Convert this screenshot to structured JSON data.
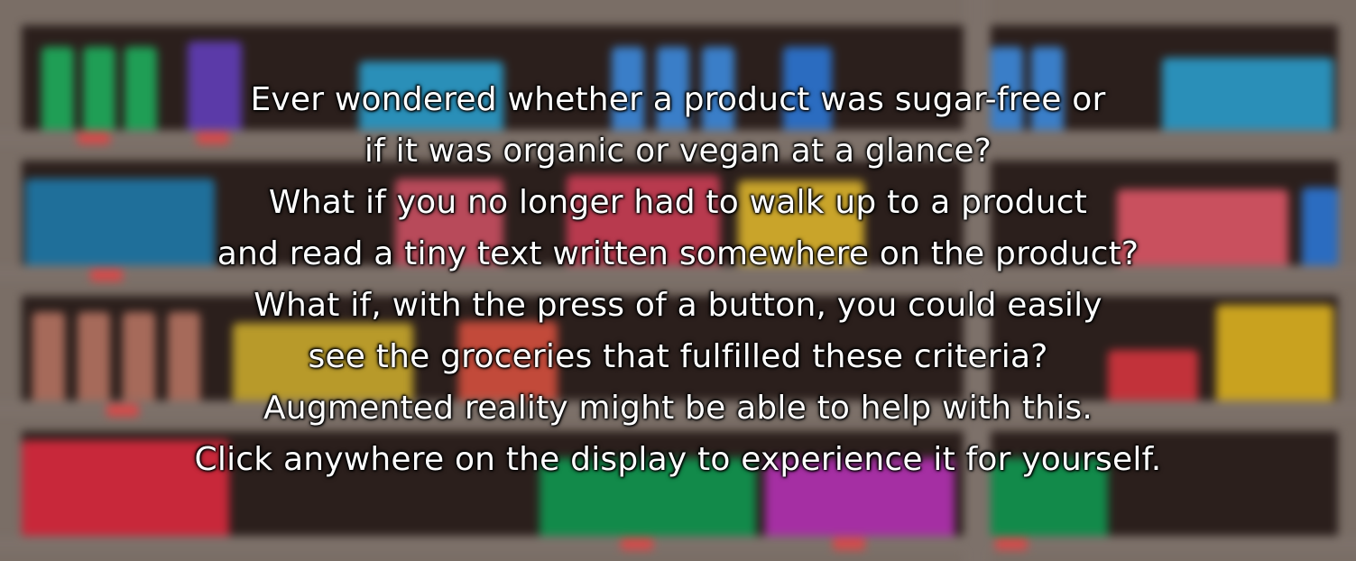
{
  "intro": {
    "lines": [
      "Ever wondered whether a product was sugar-free or",
      "if it was organic or vegan at a glance?",
      "What if you no longer had to walk up to a product",
      "and read a tiny text written somewhere on the product?",
      "What if, with the press of a button, you could easily",
      "see the groceries that fulfilled these criteria?",
      "Augmented reality might be able to help with this.",
      "Click anywhere on the display to experience it for yourself."
    ]
  },
  "colors": {
    "shelf_frame": "#7d716a",
    "shelf_back": "#2b1f1c",
    "price_tag": "#d54a4a",
    "text": "#ffffff"
  }
}
